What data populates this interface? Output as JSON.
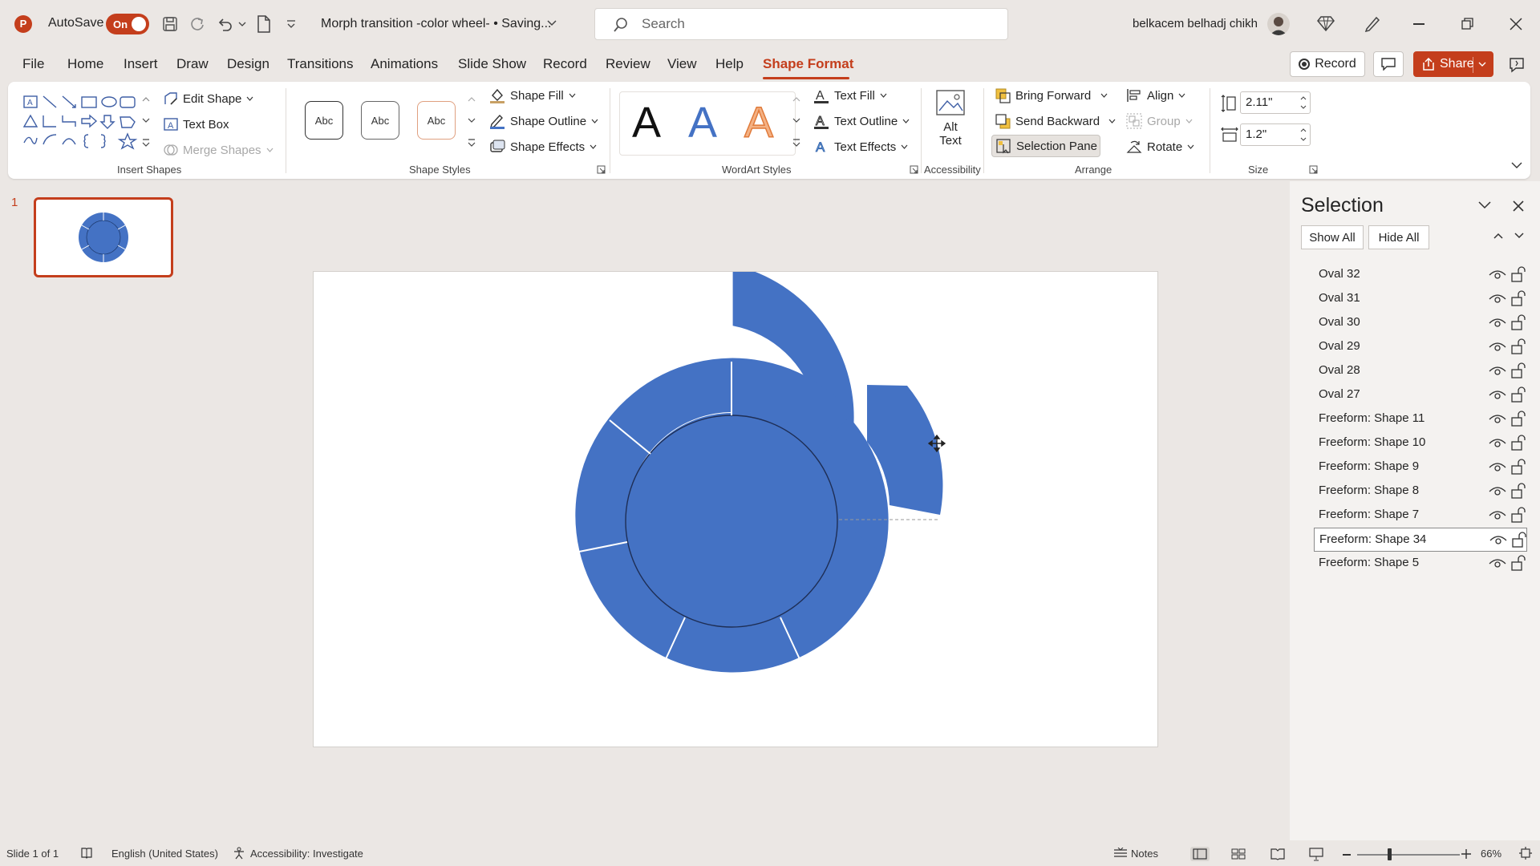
{
  "app": {
    "autosave_label": "AutoSave",
    "autosave_state": "On",
    "doc_title": "Morph transition -color wheel- • Saving...",
    "search_placeholder": "Search",
    "user_name": "belkacem belhadj chikh",
    "brand_color": "#c43e1c"
  },
  "tabs": [
    "File",
    "Home",
    "Insert",
    "Draw",
    "Design",
    "Transitions",
    "Animations",
    "Slide Show",
    "Record",
    "Review",
    "View",
    "Help",
    "Shape Format"
  ],
  "active_tab": "Shape Format",
  "header_buttons": {
    "record": "Record",
    "share": "Share"
  },
  "ribbon": {
    "insert_shapes": {
      "edit_shape": "Edit Shape",
      "text_box": "Text Box",
      "merge_shapes": "Merge Shapes",
      "group_label": "Insert Shapes"
    },
    "shape_styles": {
      "samples": [
        "Abc",
        "Abc",
        "Abc"
      ],
      "shape_fill": "Shape Fill",
      "shape_outline": "Shape Outline",
      "shape_effects": "Shape Effects",
      "group_label": "Shape Styles"
    },
    "wordart": {
      "letters": [
        "A",
        "A",
        "A"
      ],
      "text_fill": "Text Fill",
      "text_outline": "Text Outline",
      "text_effects": "Text Effects",
      "group_label": "WordArt Styles"
    },
    "accessibility": {
      "alt_text_1": "Alt",
      "alt_text_2": "Text",
      "group_label": "Accessibility"
    },
    "arrange": {
      "bring_forward": "Bring Forward",
      "send_backward": "Send Backward",
      "selection_pane": "Selection Pane",
      "align": "Align",
      "group": "Group",
      "rotate": "Rotate",
      "group_label": "Arrange"
    },
    "size": {
      "height": "2.11\"",
      "width": "1.2\"",
      "group_label": "Size"
    }
  },
  "thumbnails": {
    "slide_number": "1"
  },
  "slide": {
    "shape_color": "#4472c4"
  },
  "selection_pane": {
    "title": "Selection",
    "show_all": "Show All",
    "hide_all": "Hide All",
    "items": [
      "Oval 32",
      "Oval 31",
      "Oval 30",
      "Oval 29",
      "Oval 28",
      "Oval 27",
      "Freeform: Shape 11",
      "Freeform: Shape 10",
      "Freeform: Shape 9",
      "Freeform: Shape 8",
      "Freeform: Shape 7",
      "Freeform: Shape 34",
      "Freeform: Shape 5"
    ],
    "selected_item": "Freeform: Shape 34"
  },
  "status": {
    "slide_info": "Slide 1 of 1",
    "language": "English (United States)",
    "accessibility": "Accessibility: Investigate",
    "notes": "Notes",
    "zoom": "66%"
  }
}
